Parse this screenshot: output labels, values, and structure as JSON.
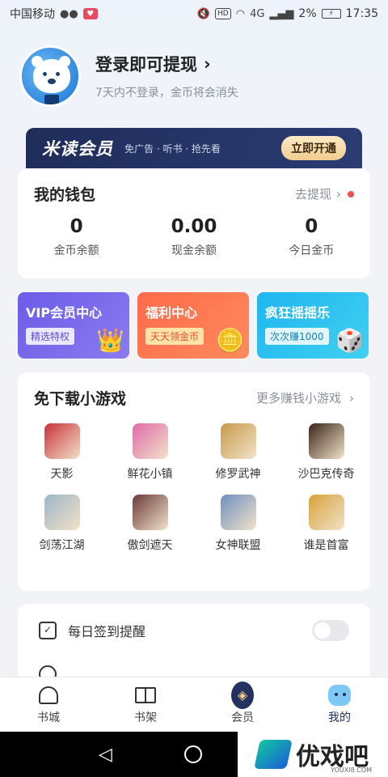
{
  "status_bar": {
    "carrier": "中国移动",
    "battery_pct": "2%",
    "time": "17:35",
    "network": "4G",
    "hd": "HD"
  },
  "profile": {
    "login_title": "登录即可提现",
    "login_sub": "7天内不登录，金币将会消失"
  },
  "member": {
    "title": "米读会员",
    "desc": "免广告 · 听书 · 抢先看",
    "button": "立即开通"
  },
  "wallet": {
    "title": "我的钱包",
    "link": "去提现",
    "stats": [
      {
        "value": "0",
        "label": "金币余额"
      },
      {
        "value": "0.00",
        "label": "现金余额"
      },
      {
        "value": "0",
        "label": "今日金币"
      }
    ]
  },
  "features": [
    {
      "title": "VIP会员中心",
      "tag": "精选特权"
    },
    {
      "title": "福利中心",
      "tag": "天天领金币"
    },
    {
      "title": "疯狂摇摇乐",
      "tag": "次次赚1000"
    }
  ],
  "games": {
    "title": "免下载小游戏",
    "link": "更多赚钱小游戏",
    "items": [
      {
        "name": "天影",
        "color": "#c8313a"
      },
      {
        "name": "鲜花小镇",
        "color": "#e06aa8"
      },
      {
        "name": "修罗武神",
        "color": "#c89a4a"
      },
      {
        "name": "沙巴克传奇",
        "color": "#3a2418"
      },
      {
        "name": "剑荡江湖",
        "color": "#9fb5c9"
      },
      {
        "name": "傲剑遮天",
        "color": "#6a3a3a"
      },
      {
        "name": "女神联盟",
        "color": "#6f8fc0"
      },
      {
        "name": "谁是首富",
        "color": "#d6a23a"
      }
    ]
  },
  "reminder": {
    "label": "每日签到提醒"
  },
  "bottom_nav": [
    {
      "label": "书城",
      "icon": "home-icon"
    },
    {
      "label": "书架",
      "icon": "bookshelf-icon"
    },
    {
      "label": "会员",
      "icon": "member-icon"
    },
    {
      "label": "我的",
      "icon": "mine-icon"
    }
  ],
  "watermark": {
    "text": "优戏吧",
    "sub": "YOUXI8.COM"
  }
}
